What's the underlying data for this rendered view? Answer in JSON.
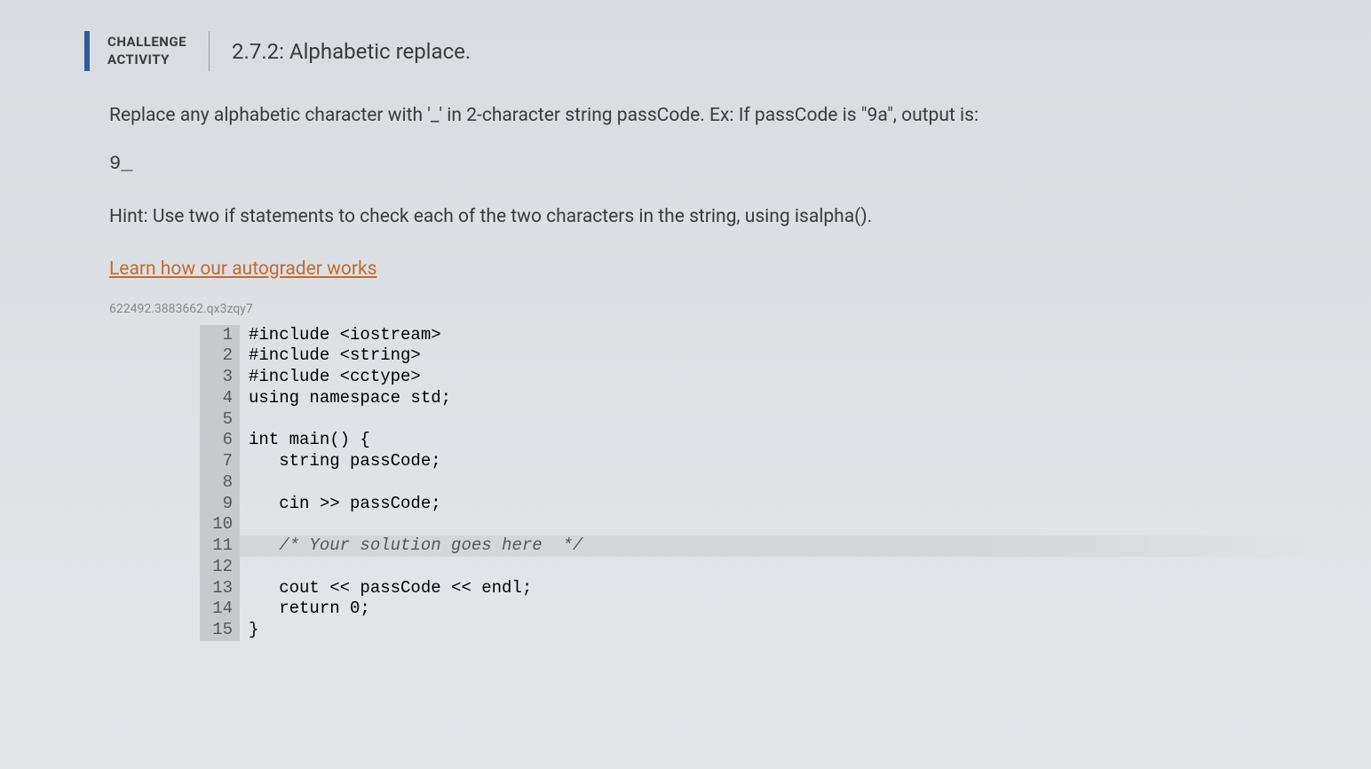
{
  "header": {
    "label_line1": "CHALLENGE",
    "label_line2": "ACTIVITY",
    "title": "2.7.2: Alphabetic replace."
  },
  "prompt": "Replace any alphabetic character with '_' in 2-character string passCode. Ex: If passCode is \"9a\", output is:",
  "output_sample": "9_",
  "hint": "Hint: Use two if statements to check each of the two characters in the string, using isalpha().",
  "learn_link": "Learn how our autograder works",
  "watermark": "622492.3883662.qx3zqy7",
  "code": {
    "lines": [
      {
        "n": "1",
        "text": "#include <iostream>"
      },
      {
        "n": "2",
        "text": "#include <string>"
      },
      {
        "n": "3",
        "text": "#include <cctype>"
      },
      {
        "n": "4",
        "text": "using namespace std;"
      },
      {
        "n": "5",
        "text": ""
      },
      {
        "n": "6",
        "text": "int main() {"
      },
      {
        "n": "7",
        "text": "   string passCode;"
      },
      {
        "n": "8",
        "text": ""
      },
      {
        "n": "9",
        "text": "   cin >> passCode;"
      },
      {
        "n": "10",
        "text": ""
      },
      {
        "n": "11",
        "text": "   /* Your solution goes here  */",
        "highlighted": true,
        "comment": true
      },
      {
        "n": "12",
        "text": ""
      },
      {
        "n": "13",
        "text": "   cout << passCode << endl;"
      },
      {
        "n": "14",
        "text": "   return 0;"
      },
      {
        "n": "15",
        "text": "}"
      }
    ]
  }
}
